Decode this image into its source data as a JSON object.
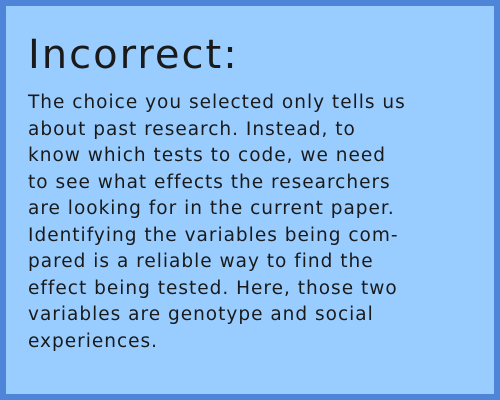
{
  "feedback": {
    "title": "Incorrect:",
    "lines": [
      "The choice you selected only tells us",
      "about past research. Instead, to",
      "know which tests to code, we need",
      "to see what effects the researchers",
      "are looking for in the current paper.",
      "Identifying the variables being com-",
      "pared is a reliable way to find the",
      "effect being tested. Here, those two",
      "variables are genotype and social",
      "experiences."
    ]
  },
  "colors": {
    "panel_background": "#99ccff",
    "panel_border": "#4f85d9",
    "text": "#1a1a1a"
  }
}
